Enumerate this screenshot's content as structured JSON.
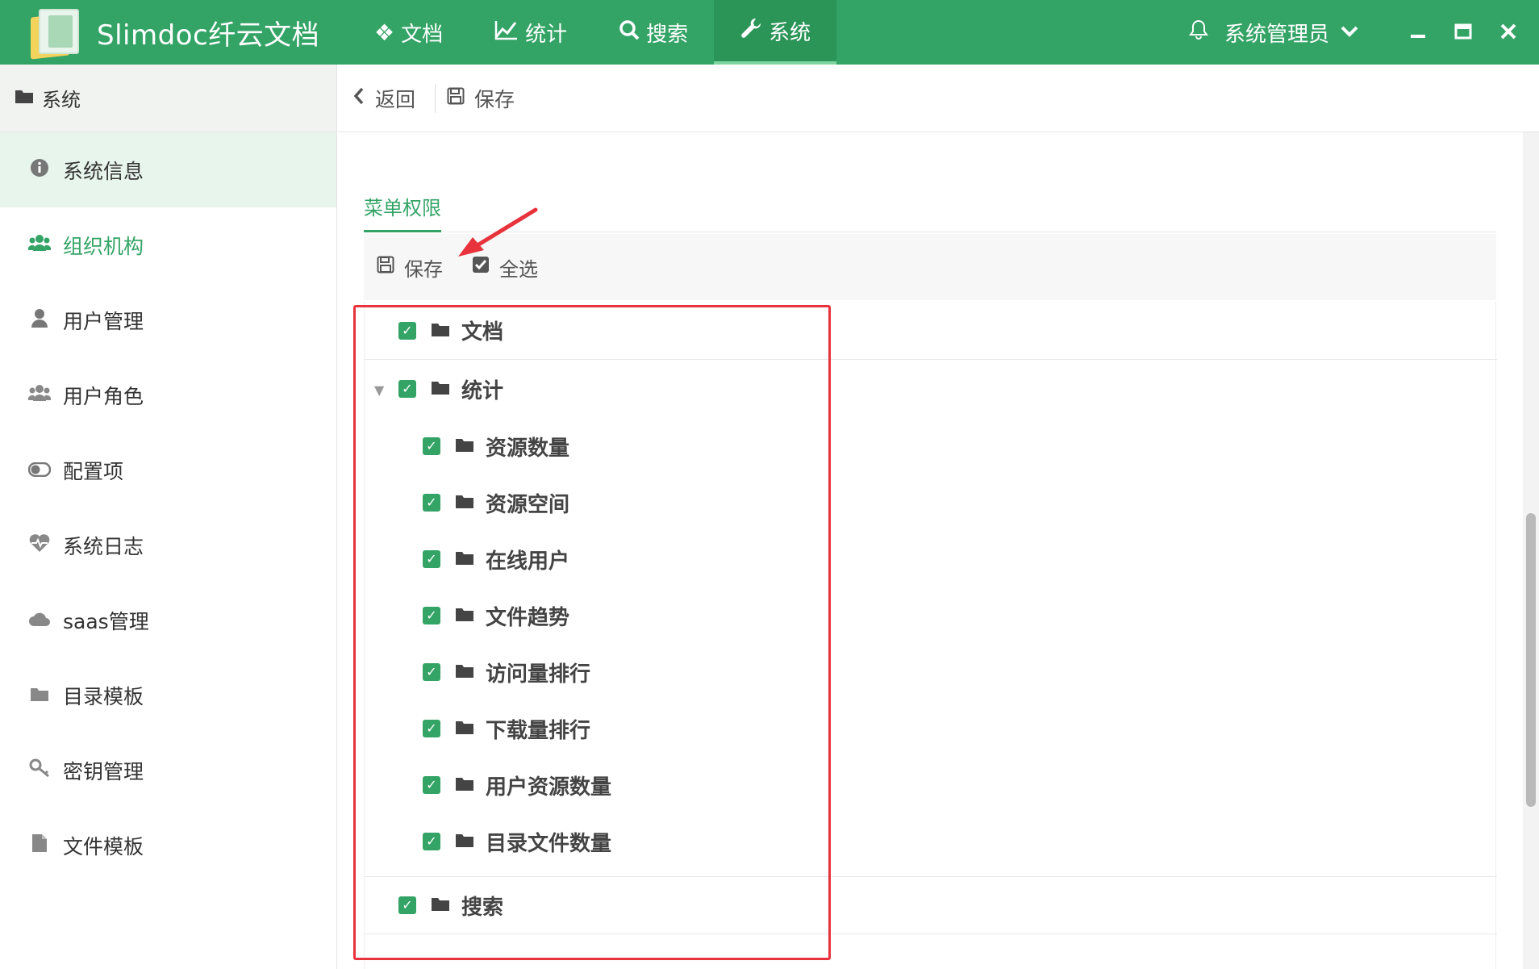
{
  "app": {
    "brand": "Slimdoc纤云文档"
  },
  "nav": [
    {
      "label": "文档",
      "icon": "cubes-icon"
    },
    {
      "label": "统计",
      "icon": "line-chart-icon"
    },
    {
      "label": "搜索",
      "icon": "search-icon"
    },
    {
      "label": "系统",
      "icon": "wrench-icon"
    }
  ],
  "user": {
    "name": "系统管理员"
  },
  "sidebar": {
    "header": "系统",
    "items": [
      {
        "label": "系统信息",
        "icon": "info-icon"
      },
      {
        "label": "组织机构",
        "icon": "users-icon"
      },
      {
        "label": "用户管理",
        "icon": "user-icon"
      },
      {
        "label": "用户角色",
        "icon": "users-icon"
      },
      {
        "label": "配置项",
        "icon": "toggle-icon"
      },
      {
        "label": "系统日志",
        "icon": "heartbeat-icon"
      },
      {
        "label": "saas管理",
        "icon": "cloud-icon"
      },
      {
        "label": "目录模板",
        "icon": "folder-icon"
      },
      {
        "label": "密钥管理",
        "icon": "key-icon"
      },
      {
        "label": "文件模板",
        "icon": "file-icon"
      }
    ]
  },
  "toolbar": {
    "back": "返回",
    "save": "保存"
  },
  "tab": {
    "label": "菜单权限"
  },
  "inner_toolbar": {
    "save": "保存",
    "select_all": "全选"
  },
  "tree": {
    "nodes": [
      {
        "label": "文档",
        "checked": true
      },
      {
        "label": "统计",
        "checked": true,
        "expanded": true
      },
      {
        "label": "资源数量",
        "checked": true
      },
      {
        "label": "资源空间",
        "checked": true
      },
      {
        "label": "在线用户",
        "checked": true
      },
      {
        "label": "文件趋势",
        "checked": true
      },
      {
        "label": "访问量排行",
        "checked": true
      },
      {
        "label": "下载量排行",
        "checked": true
      },
      {
        "label": "用户资源数量",
        "checked": true
      },
      {
        "label": "目录文件数量",
        "checked": true
      },
      {
        "label": "搜索",
        "checked": true
      }
    ]
  },
  "colors": {
    "brand_green": "#34a466",
    "annotation_red": "#e8323c"
  }
}
